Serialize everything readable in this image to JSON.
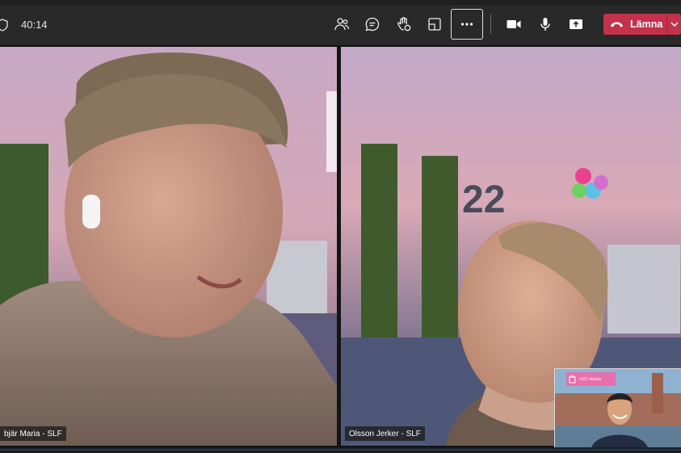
{
  "toolbar": {
    "timer": "40:14",
    "buttons": [
      {
        "name": "participants-button",
        "icon": "people-icon"
      },
      {
        "name": "chat-button",
        "icon": "chat-icon"
      },
      {
        "name": "reactions-button",
        "icon": "raise-hand-icon"
      },
      {
        "name": "rooms-button",
        "icon": "breakout-rooms-icon"
      },
      {
        "name": "more-actions-button",
        "icon": "more-icon"
      },
      {
        "name": "camera-button",
        "icon": "camera-icon"
      },
      {
        "name": "microphone-button",
        "icon": "microphone-icon"
      },
      {
        "name": "share-button",
        "icon": "share-screen-icon"
      }
    ],
    "leave_label": "Lämna",
    "colors": {
      "bar": "#292929",
      "leave": "#c4314b"
    }
  },
  "participants": [
    {
      "name": "bjär Maria - SLF"
    },
    {
      "name": "Olsson Jerker - SLF"
    }
  ],
  "pip": {
    "banner_text": "H22 ränsta"
  }
}
